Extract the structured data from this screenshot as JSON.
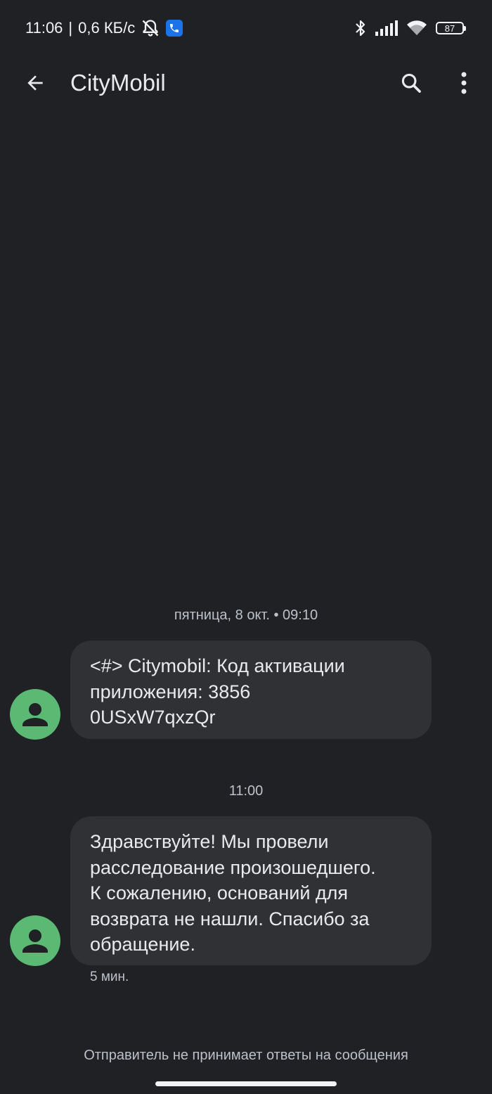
{
  "status_bar": {
    "time": "11:06",
    "separator": "|",
    "net_speed": "0,6 КБ/с",
    "battery_level": "87"
  },
  "app_bar": {
    "title": "CityMobil"
  },
  "conversation": {
    "messages": [
      {
        "timestamp": "пятница, 8 окт. • 09:10",
        "text": "<#> Citymobil:  Код активации\nприложения: 3856\n0USxW7qxzQr",
        "meta": ""
      },
      {
        "timestamp": "11:00",
        "text": "Здравствуйте! Мы провели\nрасследование произошедшего.\nК сожалению, оснований для\nвозврата не нашли. Спасибо за\nобращение.",
        "meta": "5 мин."
      }
    ]
  },
  "footer": {
    "note": "Отправитель не принимает ответы на сообщения"
  },
  "colors": {
    "background": "#202124",
    "bubble": "#303134",
    "avatar": "#5bb974",
    "accent_badge": "#1a73e8"
  }
}
